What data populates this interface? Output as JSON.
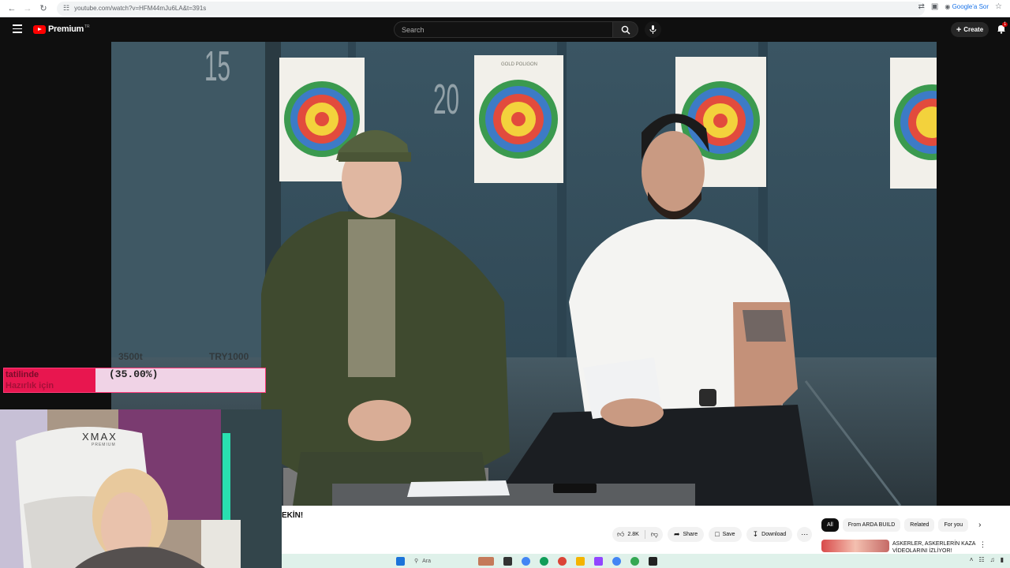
{
  "browser": {
    "url": "youtube.com/watch?v=HFM44mJu6LA&t=391s",
    "right_action": "Google'a Sor"
  },
  "youtube": {
    "logo_text": "Premium",
    "logo_sup": "TR",
    "search_placeholder": "Search",
    "create_label": "Create",
    "notification_count": "1"
  },
  "video": {
    "lane_numbers": [
      "15",
      "20"
    ],
    "target_brand": "GOLD POLIGON"
  },
  "stream_overlay": {
    "price_left": "3500t",
    "price_right": "TRY1000",
    "goal_label_line1": "tatilinde",
    "goal_label_line2": "Hazırlık için",
    "goal_percent_text": "(35.00%)",
    "goal_progress": 0.35,
    "chair_brand": "XMAX",
    "chair_sub": "PREMIUM"
  },
  "watch_page": {
    "title_fragment": "EKİN!",
    "actions": {
      "like_count": "2.8K",
      "share": "Share",
      "save": "Save",
      "download": "Download"
    },
    "chips": [
      "All",
      "From ARDA BUILD",
      "Related",
      "For you"
    ],
    "recommended": [
      {
        "title": "ASKERLER, ASKERLERİN KAZA VİDEOLARINI İZLİYOR!"
      }
    ]
  },
  "taskbar": {
    "search_placeholder": "Ara"
  },
  "colors": {
    "yt_red": "#ff0000",
    "goal_fill": "#e8164f",
    "goal_bg": "#f0d3e6"
  }
}
